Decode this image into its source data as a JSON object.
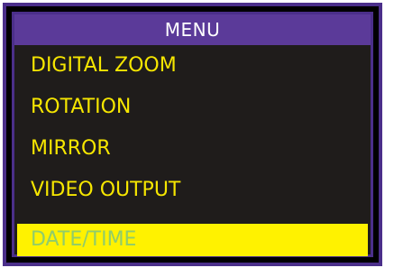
{
  "menu": {
    "title": "MENU",
    "items": [
      {
        "label": "DIGITAL ZOOM",
        "selected": false
      },
      {
        "label": "ROTATION",
        "selected": false
      },
      {
        "label": "MIRROR",
        "selected": false
      },
      {
        "label": "VIDEO OUTPUT",
        "selected": false
      },
      {
        "label": "DATE/TIME",
        "selected": true
      }
    ]
  },
  "colors": {
    "frame_border": "#4b2f8a",
    "header_bg": "#5b3a99",
    "panel_bg": "#1f1c1b",
    "item_text": "#f6e600",
    "selected_bg": "#fff200",
    "selected_text": "#8fcc6b"
  }
}
